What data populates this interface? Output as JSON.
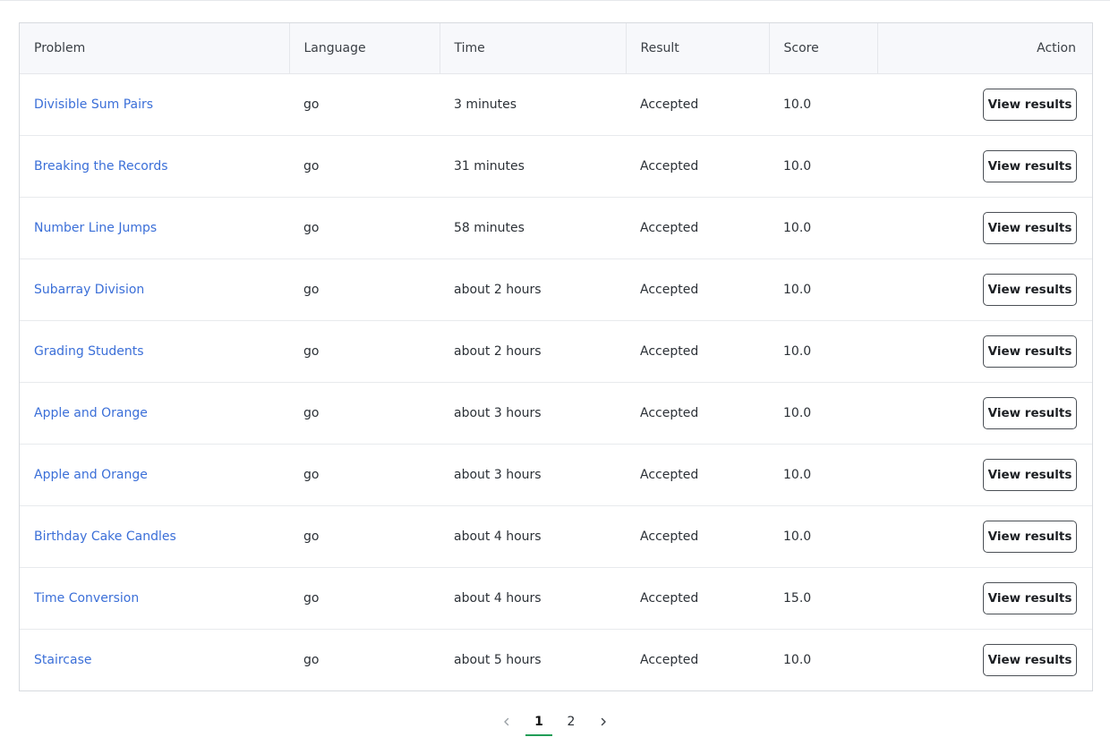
{
  "table": {
    "columns": [
      "Problem",
      "Language",
      "Time",
      "Result",
      "Score",
      "Action"
    ],
    "rows": [
      {
        "problem": "Divisible Sum Pairs",
        "language": "go",
        "time": "3 minutes",
        "result": "Accepted",
        "score": "10.0",
        "action": "View results"
      },
      {
        "problem": "Breaking the Records",
        "language": "go",
        "time": "31 minutes",
        "result": "Accepted",
        "score": "10.0",
        "action": "View results"
      },
      {
        "problem": "Number Line Jumps",
        "language": "go",
        "time": "58 minutes",
        "result": "Accepted",
        "score": "10.0",
        "action": "View results"
      },
      {
        "problem": "Subarray Division",
        "language": "go",
        "time": "about 2 hours",
        "result": "Accepted",
        "score": "10.0",
        "action": "View results"
      },
      {
        "problem": "Grading Students",
        "language": "go",
        "time": "about 2 hours",
        "result": "Accepted",
        "score": "10.0",
        "action": "View results"
      },
      {
        "problem": "Apple and Orange",
        "language": "go",
        "time": "about 3 hours",
        "result": "Accepted",
        "score": "10.0",
        "action": "View results"
      },
      {
        "problem": "Apple and Orange",
        "language": "go",
        "time": "about 3 hours",
        "result": "Accepted",
        "score": "10.0",
        "action": "View results"
      },
      {
        "problem": "Birthday Cake Candles",
        "language": "go",
        "time": "about 4 hours",
        "result": "Accepted",
        "score": "10.0",
        "action": "View results"
      },
      {
        "problem": "Time Conversion",
        "language": "go",
        "time": "about 4 hours",
        "result": "Accepted",
        "score": "15.0",
        "action": "View results"
      },
      {
        "problem": "Staircase",
        "language": "go",
        "time": "about 5 hours",
        "result": "Accepted",
        "score": "10.0",
        "action": "View results"
      }
    ]
  },
  "pagination": {
    "pages": [
      "1",
      "2"
    ],
    "current": "1",
    "prev_icon": "chevron-left-icon",
    "next_icon": "chevron-right-icon"
  },
  "colors": {
    "link": "#3b6fd8",
    "active_page_underline": "#1f9d55",
    "header_bg": "#f7f8fb"
  }
}
